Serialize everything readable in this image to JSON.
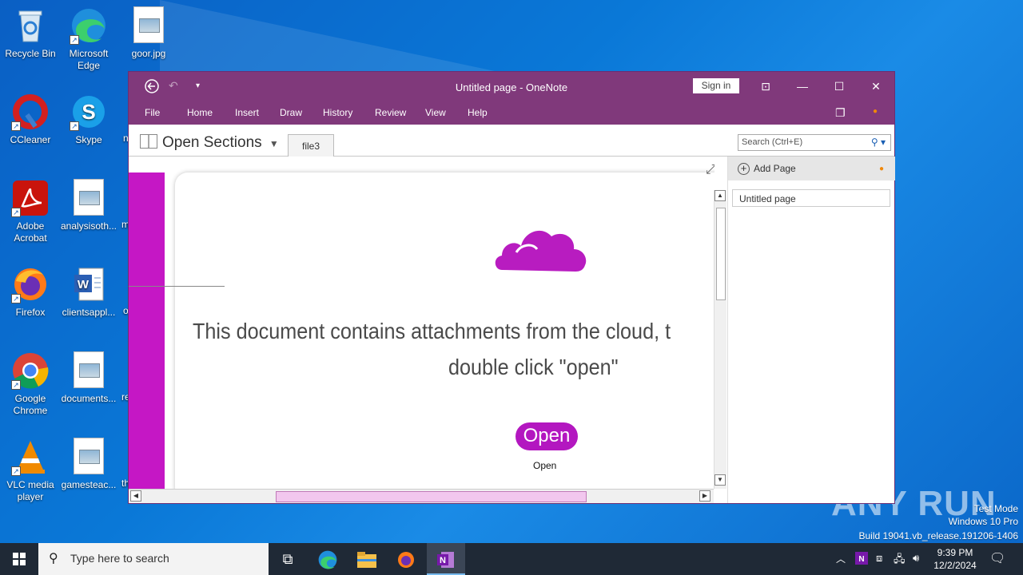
{
  "desktop": {
    "icons": [
      {
        "label": "Recycle Bin",
        "icon": "recycle-bin-icon"
      },
      {
        "label": "Microsoft Edge",
        "icon": "edge-icon"
      },
      {
        "label": "goor.jpg",
        "icon": "image-file-icon"
      },
      {
        "label": "CCleaner",
        "icon": "ccleaner-icon"
      },
      {
        "label": "Skype",
        "icon": "skype-icon"
      },
      {
        "label": "Adobe Acrobat",
        "icon": "acrobat-icon"
      },
      {
        "label": "analysisoth...",
        "icon": "image-file-icon"
      },
      {
        "label": "Firefox",
        "icon": "firefox-icon"
      },
      {
        "label": "clientsappl...",
        "icon": "word-file-icon"
      },
      {
        "label": "Google Chrome",
        "icon": "chrome-icon"
      },
      {
        "label": "documents...",
        "icon": "image-file-icon"
      },
      {
        "label": "VLC media player",
        "icon": "vlc-icon"
      },
      {
        "label": "gamesteac...",
        "icon": "image-file-icon"
      }
    ],
    "partial_labels": [
      "n",
      "m",
      "o",
      "re",
      "th"
    ]
  },
  "onenote": {
    "window_title": "Untitled page  -  OneNote",
    "sign_in": "Sign in",
    "menu": [
      "File",
      "Home",
      "Insert",
      "Draw",
      "History",
      "Review",
      "View",
      "Help"
    ],
    "notebook": "Open Sections",
    "section_tab": "file3",
    "search_placeholder": "Search (Ctrl+E)",
    "add_page": "Add Page",
    "pages": [
      "Untitled page"
    ],
    "page_content": {
      "line1": "This document contains attachments from the cloud, t",
      "line2": "double click \"open\"",
      "button": "Open",
      "caption": "Open"
    }
  },
  "watermark": {
    "logo": "ANY RUN",
    "lines": [
      "Test Mode",
      "Windows 10 Pro",
      "Build 19041.vb_release.191206-1406"
    ]
  },
  "taskbar": {
    "search_placeholder": "Type here to search",
    "time": "9:39 PM",
    "date": "12/2/2024"
  },
  "colors": {
    "onenote_purple": "#80397b",
    "content_magenta": "#c517c5",
    "desktop_blue": "#0a78d7"
  }
}
